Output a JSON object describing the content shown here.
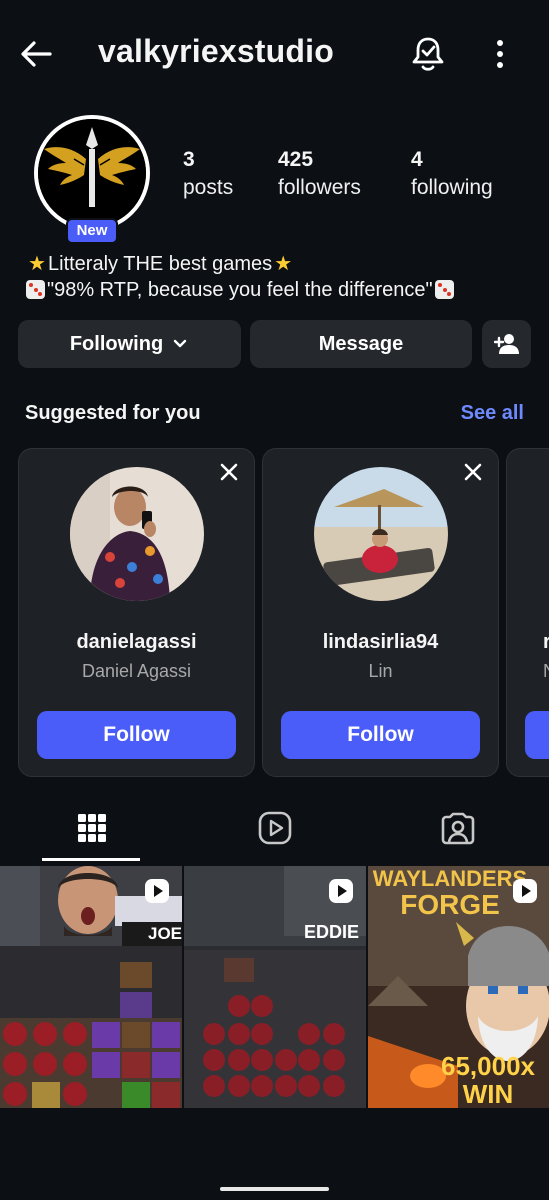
{
  "header": {
    "username": "valkyriexstudio"
  },
  "profile": {
    "badge": "New",
    "stats": [
      {
        "value": "3",
        "label": "posts"
      },
      {
        "value": "425",
        "label": "followers"
      },
      {
        "value": "4",
        "label": "following"
      }
    ],
    "bio_line1": "Litteraly THE best games",
    "bio_line2": "\"98% RTP, because you feel the difference\""
  },
  "actions": {
    "following_label": "Following",
    "message_label": "Message"
  },
  "suggested": {
    "title": "Suggested for you",
    "see_all": "See all",
    "cards": [
      {
        "handle": "danielagassi",
        "name": "Daniel Agassi",
        "follow": "Follow"
      },
      {
        "handle": "lindasirlia94",
        "name": "Lin",
        "follow": "Follow"
      }
    ],
    "peek_handle": "r",
    "peek_name": "N"
  },
  "grid": {
    "posts": [
      {
        "overlay_text": "JOE"
      },
      {
        "overlay_text": "EDDIE"
      },
      {
        "title_line1": "WAYLANDERS",
        "title_line2": "FORGE",
        "win_amount": "65,000x",
        "win_label": "WIN"
      }
    ]
  },
  "colors": {
    "background": "#0c1014",
    "accent": "#4a5df9",
    "link": "#6e8aff",
    "button": "#25292e"
  }
}
